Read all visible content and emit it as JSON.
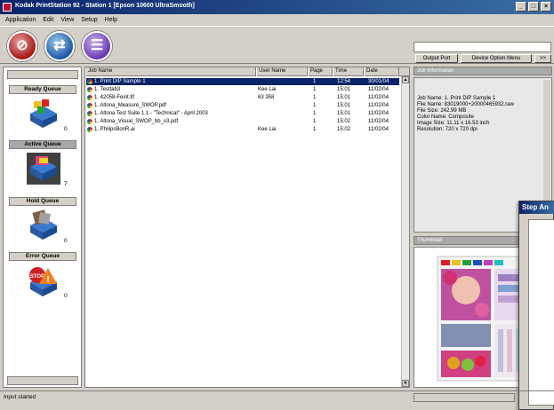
{
  "window": {
    "title": "Kodak PrintStation 92 - Station 1 [Epson 10600 UltraSmooth]",
    "controls": [
      "_",
      "□",
      "×"
    ]
  },
  "menu": [
    "Application",
    "Edit",
    "View",
    "Setup",
    "Help"
  ],
  "toolbar": {
    "buttons": [
      {
        "name": "stop",
        "icon": "stop-icon"
      },
      {
        "name": "resume",
        "icon": "arrows-icon"
      },
      {
        "name": "job",
        "icon": "stripes-icon"
      }
    ],
    "output_port_label": "Output Port",
    "device_options_label": "Device Option Menu",
    "more_label": ">>"
  },
  "queues": [
    {
      "label": "Ready Queue",
      "count": "0",
      "active": false,
      "icon": "ready-queue-icon"
    },
    {
      "label": "Active Queue",
      "count": "7",
      "active": true,
      "icon": "active-queue-icon"
    },
    {
      "label": "Hold Queue",
      "count": "0",
      "active": false,
      "icon": "hold-queue-icon"
    },
    {
      "label": "Error Queue",
      "count": "0",
      "active": false,
      "icon": "error-queue-icon"
    }
  ],
  "jobs": {
    "columns": [
      "Job Name",
      "User Name",
      "Page",
      "Time",
      "Date"
    ],
    "rows": [
      {
        "name": "1. Print DIP Sample 1",
        "user": "",
        "page": "1",
        "time": "12:54",
        "date": "30/01/04",
        "selected": true
      },
      {
        "name": "1. Testtab3",
        "user": "Kee Lai",
        "page": "1",
        "time": "15:01",
        "date": "11/02/04",
        "selected": false
      },
      {
        "name": "1. 42058-Feint.tif",
        "user": "63 358",
        "page": "1",
        "time": "15:01",
        "date": "11/02/04",
        "selected": false
      },
      {
        "name": "1. Altona_Measure_SWOP.pdf",
        "user": "",
        "page": "1",
        "time": "15:01",
        "date": "11/02/04",
        "selected": false
      },
      {
        "name": "1. Altona Test Suite 1.1 - \"Technical\" - April 2003",
        "user": "",
        "page": "1",
        "time": "15:01",
        "date": "11/02/04",
        "selected": false
      },
      {
        "name": "1. Altona_Visual_SWOP_bb_v3.pdf",
        "user": "",
        "page": "1",
        "time": "15:02",
        "date": "11/02/04",
        "selected": false
      },
      {
        "name": "1. PhilipsBonR.ai",
        "user": "Kee Lai",
        "page": "1",
        "time": "15:02",
        "date": "11/02/04",
        "selected": false
      }
    ]
  },
  "job_information": {
    "header": "Job Information",
    "lines": [
      "Job Name: 1. Print DIP Sample 1",
      "File Name: 83019000+20000465932.raw",
      "File Size: 242.99 MB",
      "Color Name: Composite",
      "Image Size: 11.11 x 16.53 inch",
      "Resolution: 720 x 720 dpi"
    ]
  },
  "thumbnail": {
    "header": "Thumbnail"
  },
  "dialog": {
    "title": "Step An"
  },
  "status": {
    "text": "Input started"
  }
}
